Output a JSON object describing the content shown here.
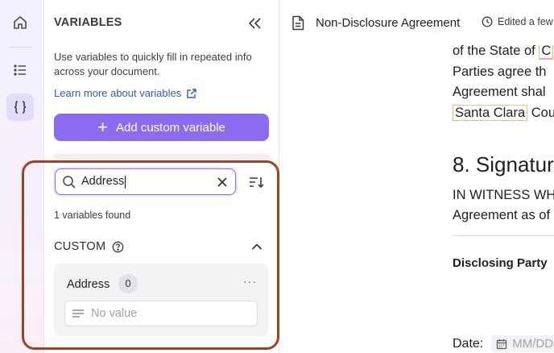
{
  "rail": {
    "items": [
      {
        "name": "home-icon",
        "active": false
      },
      {
        "name": "list-icon",
        "active": false
      },
      {
        "name": "braces-icon",
        "active": true
      }
    ]
  },
  "panel": {
    "title": "VARIABLES",
    "description": "Use variables to quickly fill in repeated info across your document.",
    "learn_more": "Learn more about variables",
    "add_button": "Add custom variable",
    "search": {
      "value": "Address"
    },
    "results_text": "1 variables found",
    "section": {
      "label": "CUSTOM"
    },
    "variables": [
      {
        "name": "Address",
        "count": "0",
        "more": "···",
        "placeholder": "No value"
      }
    ]
  },
  "document": {
    "title": "Non-Disclosure Agreement",
    "edited": "Edited a few",
    "lines": {
      "l1a": "of the State of ",
      "l1b": "C",
      "l2": "Parties agree th",
      "l3": "Agreement shal",
      "l4a": "Santa Clara",
      "l4b": " Cou"
    },
    "heading": "8. Signatur",
    "witness1": "IN WITNESS WH",
    "witness2": "Agreement as of",
    "disclosing": "Disclosing Party",
    "date_label": "Date:",
    "date_placeholder": "MM/DD"
  },
  "colors": {
    "accent": "#8b6cf0",
    "highlight_border": "#9c4524",
    "link": "#2f5fb3"
  }
}
